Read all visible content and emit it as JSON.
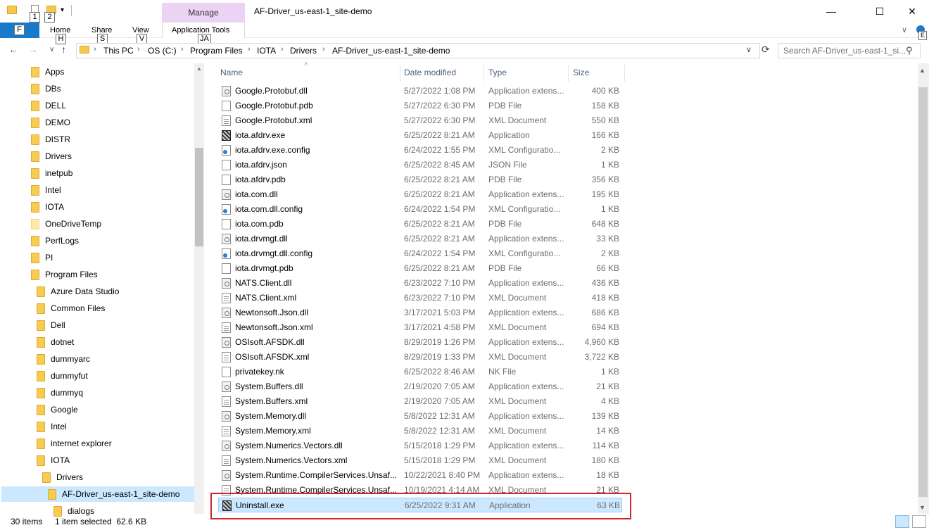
{
  "window": {
    "title": "AF-Driver_us-east-1_site-demo",
    "minimize": "—",
    "maximize": "☐",
    "close": "✕"
  },
  "qat": {
    "badge1": "1",
    "badge2": "2",
    "dropdown": "▾"
  },
  "ribbon": {
    "context_label": "Manage",
    "file": "F",
    "tabs": [
      {
        "label": "Home",
        "key": "H"
      },
      {
        "label": "Share",
        "key": "S"
      },
      {
        "label": "View",
        "key": "V"
      },
      {
        "label": "Application Tools",
        "key": "JA"
      }
    ],
    "collapse": "∨",
    "help_key": "E"
  },
  "nav": {
    "back": "←",
    "forward": "→",
    "recent": "∨",
    "up": "↑"
  },
  "breadcrumbs": [
    "This PC",
    "OS (C:)",
    "Program Files",
    "IOTA",
    "Drivers",
    "AF-Driver_us-east-1_site-demo"
  ],
  "breadcrumb_sep": "›",
  "address_dropdown": "∨",
  "search": {
    "placeholder": "Search AF-Driver_us-east-1_si...",
    "icon": "search-icon"
  },
  "navpane": {
    "items": [
      {
        "label": "Apps",
        "indent": 0
      },
      {
        "label": "DBs",
        "indent": 0
      },
      {
        "label": "DELL",
        "indent": 0
      },
      {
        "label": "DEMO",
        "indent": 0
      },
      {
        "label": "DISTR",
        "indent": 0
      },
      {
        "label": "Drivers",
        "indent": 0
      },
      {
        "label": "inetpub",
        "indent": 0
      },
      {
        "label": "Intel",
        "indent": 0
      },
      {
        "label": "IOTA",
        "indent": 0
      },
      {
        "label": "OneDriveTemp",
        "indent": 0,
        "light": true
      },
      {
        "label": "PerfLogs",
        "indent": 0
      },
      {
        "label": "PI",
        "indent": 0
      },
      {
        "label": "Program Files",
        "indent": 0
      },
      {
        "label": "Azure Data Studio",
        "indent": 1
      },
      {
        "label": "Common Files",
        "indent": 1
      },
      {
        "label": "Dell",
        "indent": 1
      },
      {
        "label": "dotnet",
        "indent": 1
      },
      {
        "label": "dummyarc",
        "indent": 1
      },
      {
        "label": "dummyfut",
        "indent": 1
      },
      {
        "label": "dummyq",
        "indent": 1
      },
      {
        "label": "Google",
        "indent": 1
      },
      {
        "label": "Intel",
        "indent": 1
      },
      {
        "label": "internet explorer",
        "indent": 1
      },
      {
        "label": "IOTA",
        "indent": 1
      },
      {
        "label": "Drivers",
        "indent": 2
      },
      {
        "label": "AF-Driver_us-east-1_site-demo",
        "indent": 3,
        "selected": true
      },
      {
        "label": "dialogs",
        "indent": 4
      }
    ]
  },
  "columns": {
    "name": "Name",
    "date": "Date modified",
    "type": "Type",
    "size": "Size",
    "sort_arrow": "˄"
  },
  "files": [
    {
      "name": "Google.Protobuf.dll",
      "date": "5/27/2022 1:08 PM",
      "type": "Application extens...",
      "size": "400 KB",
      "kind": "dll"
    },
    {
      "name": "Google.Protobuf.pdb",
      "date": "5/27/2022 6:30 PM",
      "type": "PDB File",
      "size": "158 KB",
      "kind": "file"
    },
    {
      "name": "Google.Protobuf.xml",
      "date": "5/27/2022 6:30 PM",
      "type": "XML Document",
      "size": "550 KB",
      "kind": "xml"
    },
    {
      "name": "iota.afdrv.exe",
      "date": "6/25/2022 8:21 AM",
      "type": "Application",
      "size": "166 KB",
      "kind": "exe"
    },
    {
      "name": "iota.afdrv.exe.config",
      "date": "6/24/2022 1:55 PM",
      "type": "XML Configuratio...",
      "size": "2 KB",
      "kind": "config"
    },
    {
      "name": "iota.afdrv.json",
      "date": "6/25/2022 8:45 AM",
      "type": "JSON File",
      "size": "1 KB",
      "kind": "file"
    },
    {
      "name": "iota.afdrv.pdb",
      "date": "6/25/2022 8:21 AM",
      "type": "PDB File",
      "size": "356 KB",
      "kind": "file"
    },
    {
      "name": "iota.com.dll",
      "date": "6/25/2022 8:21 AM",
      "type": "Application extens...",
      "size": "195 KB",
      "kind": "dll"
    },
    {
      "name": "iota.com.dll.config",
      "date": "6/24/2022 1:54 PM",
      "type": "XML Configuratio...",
      "size": "1 KB",
      "kind": "config"
    },
    {
      "name": "iota.com.pdb",
      "date": "6/25/2022 8:21 AM",
      "type": "PDB File",
      "size": "648 KB",
      "kind": "file"
    },
    {
      "name": "iota.drvmgt.dll",
      "date": "6/25/2022 8:21 AM",
      "type": "Application extens...",
      "size": "33 KB",
      "kind": "dll"
    },
    {
      "name": "iota.drvmgt.dll.config",
      "date": "6/24/2022 1:54 PM",
      "type": "XML Configuratio...",
      "size": "2 KB",
      "kind": "config"
    },
    {
      "name": "iota.drvmgt.pdb",
      "date": "6/25/2022 8:21 AM",
      "type": "PDB File",
      "size": "66 KB",
      "kind": "file"
    },
    {
      "name": "NATS.Client.dll",
      "date": "6/23/2022 7:10 PM",
      "type": "Application extens...",
      "size": "436 KB",
      "kind": "dll"
    },
    {
      "name": "NATS.Client.xml",
      "date": "6/23/2022 7:10 PM",
      "type": "XML Document",
      "size": "418 KB",
      "kind": "xml"
    },
    {
      "name": "Newtonsoft.Json.dll",
      "date": "3/17/2021 5:03 PM",
      "type": "Application extens...",
      "size": "686 KB",
      "kind": "dll"
    },
    {
      "name": "Newtonsoft.Json.xml",
      "date": "3/17/2021 4:58 PM",
      "type": "XML Document",
      "size": "694 KB",
      "kind": "xml"
    },
    {
      "name": "OSIsoft.AFSDK.dll",
      "date": "8/29/2019 1:26 PM",
      "type": "Application extens...",
      "size": "4,960 KB",
      "kind": "dll"
    },
    {
      "name": "OSIsoft.AFSDK.xml",
      "date": "8/29/2019 1:33 PM",
      "type": "XML Document",
      "size": "3,722 KB",
      "kind": "xml"
    },
    {
      "name": "privatekey.nk",
      "date": "6/25/2022 8:46 AM",
      "type": "NK File",
      "size": "1 KB",
      "kind": "file"
    },
    {
      "name": "System.Buffers.dll",
      "date": "2/19/2020 7:05 AM",
      "type": "Application extens...",
      "size": "21 KB",
      "kind": "dll"
    },
    {
      "name": "System.Buffers.xml",
      "date": "2/19/2020 7:05 AM",
      "type": "XML Document",
      "size": "4 KB",
      "kind": "xml"
    },
    {
      "name": "System.Memory.dll",
      "date": "5/8/2022 12:31 AM",
      "type": "Application extens...",
      "size": "139 KB",
      "kind": "dll"
    },
    {
      "name": "System.Memory.xml",
      "date": "5/8/2022 12:31 AM",
      "type": "XML Document",
      "size": "14 KB",
      "kind": "xml"
    },
    {
      "name": "System.Numerics.Vectors.dll",
      "date": "5/15/2018 1:29 PM",
      "type": "Application extens...",
      "size": "114 KB",
      "kind": "dll"
    },
    {
      "name": "System.Numerics.Vectors.xml",
      "date": "5/15/2018 1:29 PM",
      "type": "XML Document",
      "size": "180 KB",
      "kind": "xml"
    },
    {
      "name": "System.Runtime.CompilerServices.Unsaf...",
      "date": "10/22/2021 8:40 PM",
      "type": "Application extens...",
      "size": "18 KB",
      "kind": "dll"
    },
    {
      "name": "System.Runtime.CompilerServices.Unsaf...",
      "date": "10/19/2021 4:14 AM",
      "type": "XML Document",
      "size": "21 KB",
      "kind": "xml"
    },
    {
      "name": "Uninstall.exe",
      "date": "6/25/2022 9:31 AM",
      "type": "Application",
      "size": "63 KB",
      "kind": "exe",
      "selected": true
    }
  ],
  "status": {
    "count": "30 items",
    "selection": "1 item selected  62.6 KB"
  },
  "colors": {
    "accent": "#1979ca",
    "selection": "#cce8ff",
    "manage_ctx": "#ecd3f4",
    "highlight": "#d1242b"
  }
}
